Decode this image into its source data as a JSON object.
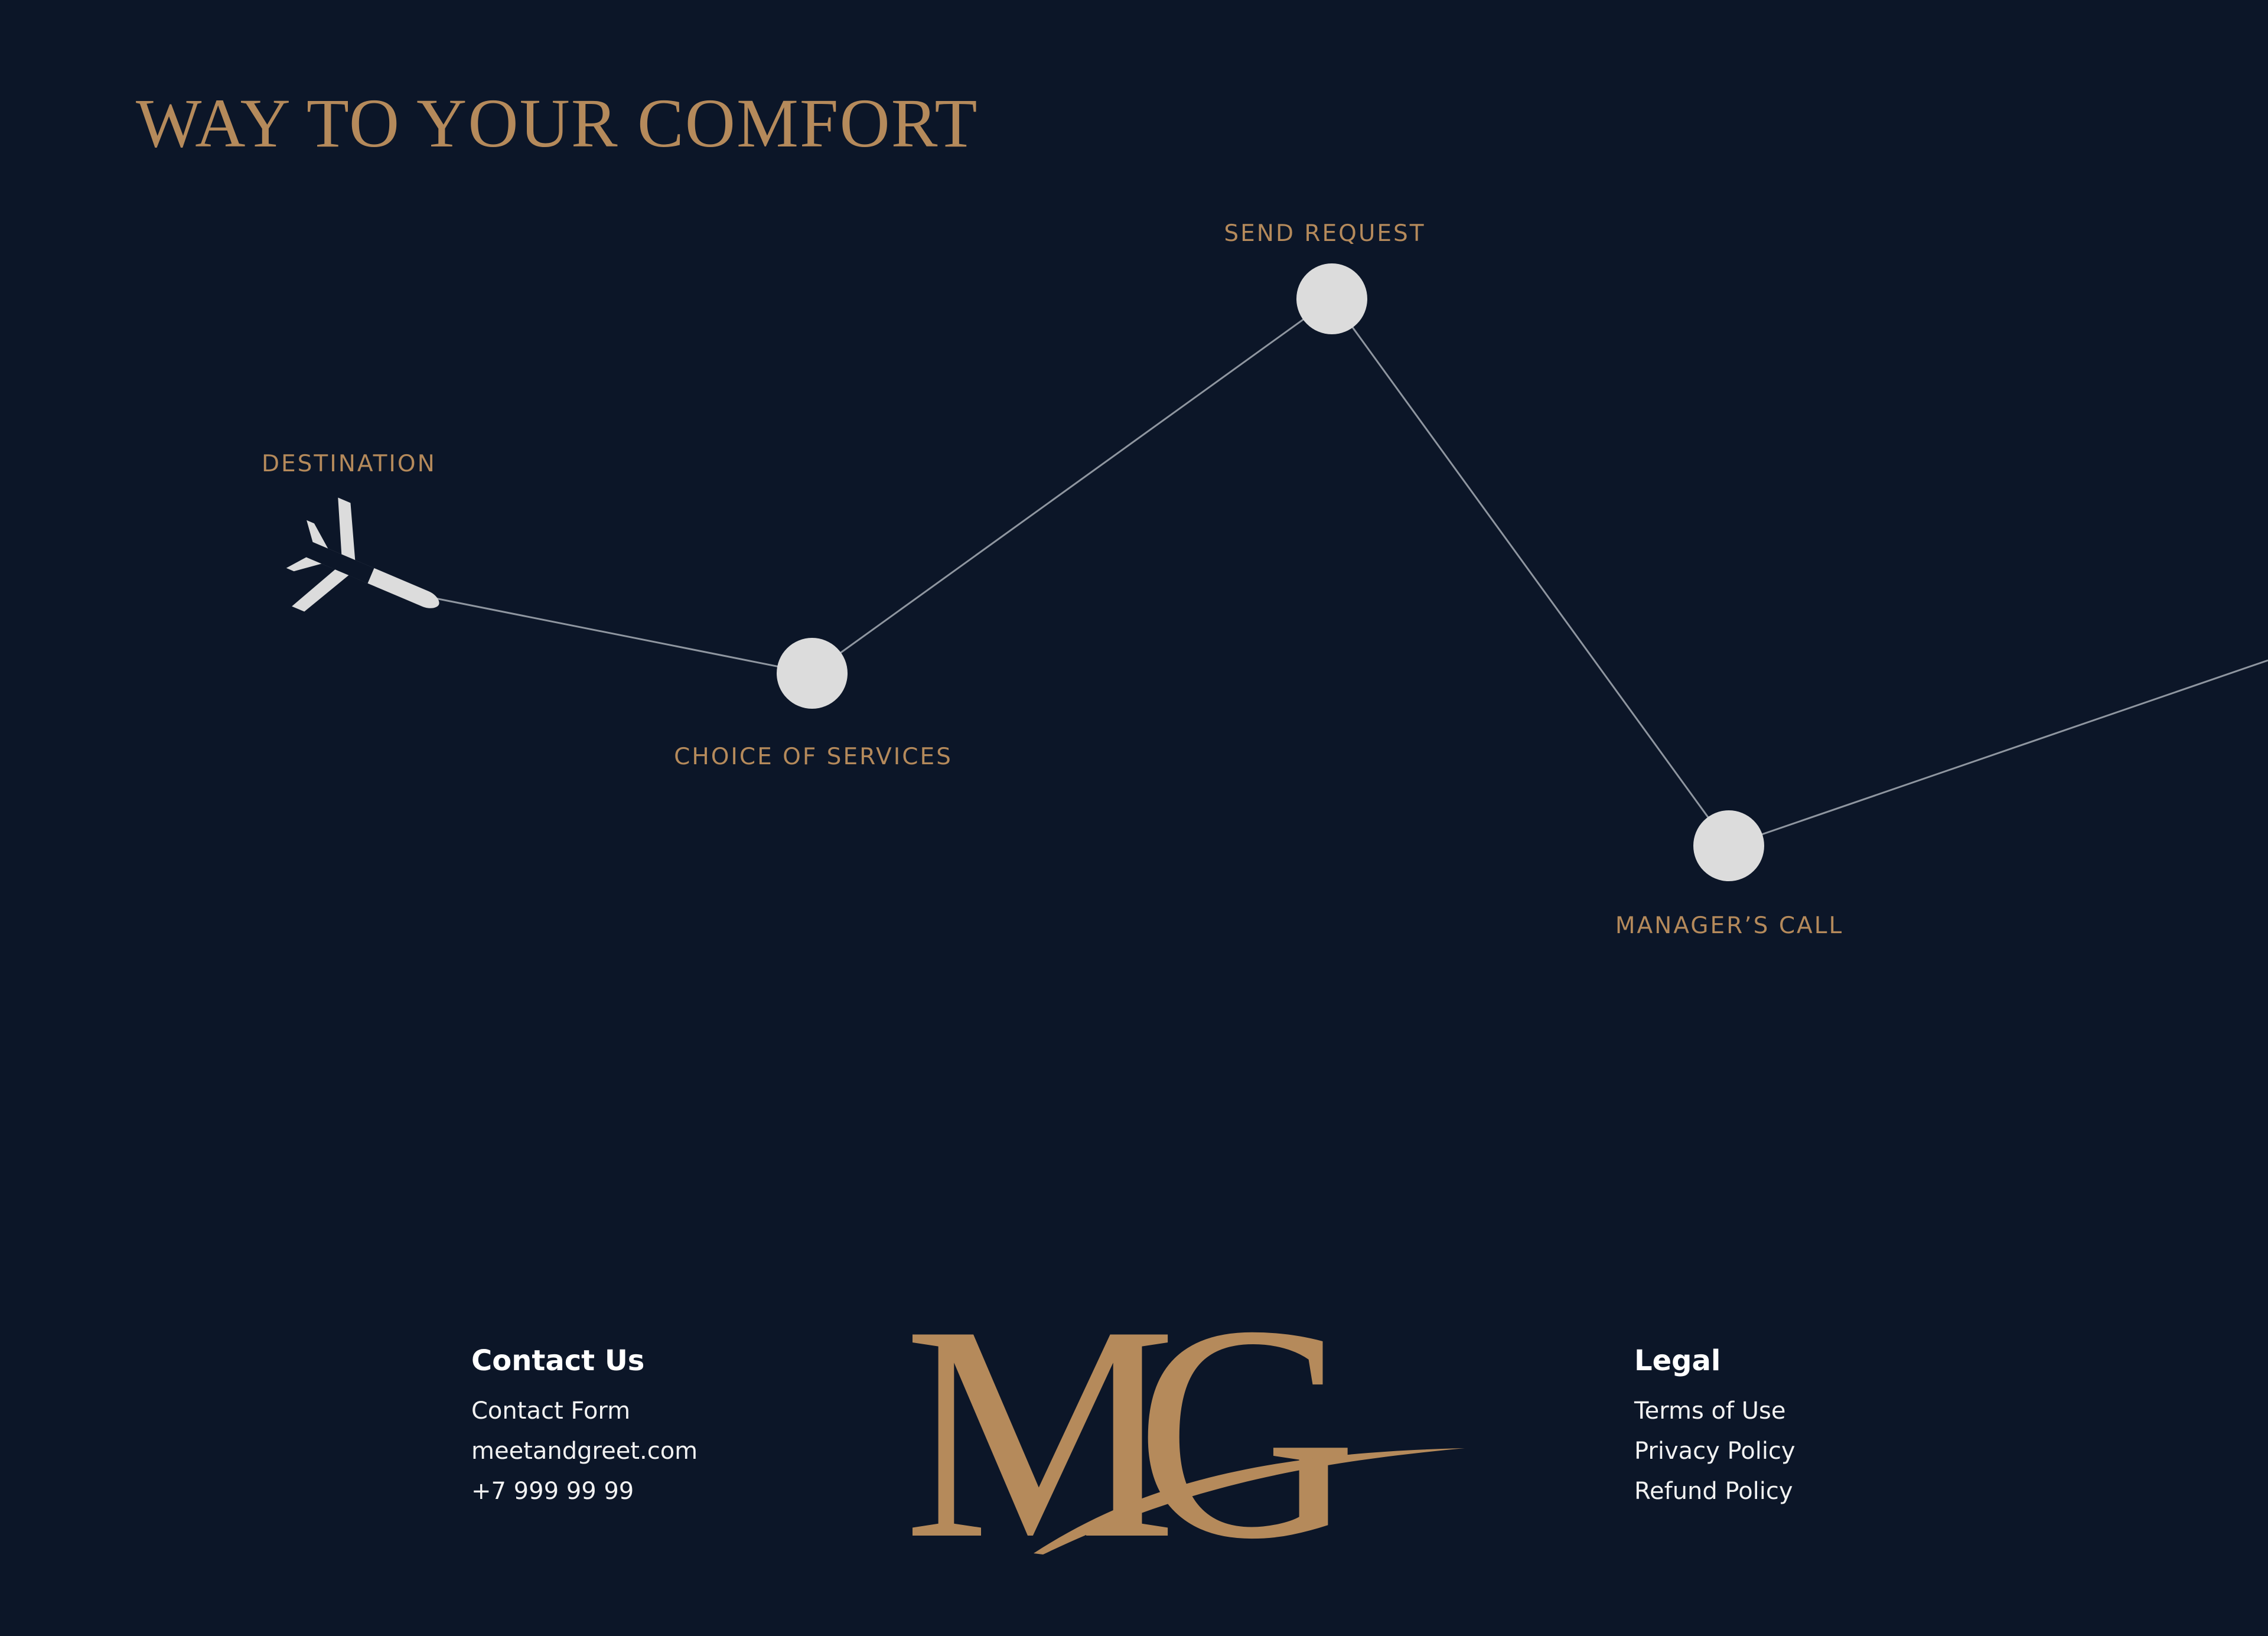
{
  "page": {
    "title": "WAY TO YOUR COMFORT",
    "colors": {
      "background": "#0c1628",
      "accent_gold": "#b58a5b",
      "node": "#dcdcdc",
      "line": "#8f96a0",
      "footer_text": "#ffffff"
    }
  },
  "route": {
    "icon": "airplane-icon",
    "steps": [
      {
        "label": "DESTINATION",
        "marker": "airplane"
      },
      {
        "label": "CHOICE OF SERVICES",
        "marker": "circle"
      },
      {
        "label": "SEND REQUEST",
        "marker": "circle"
      },
      {
        "label": "MANAGER’S CALL",
        "marker": "circle"
      }
    ]
  },
  "footer": {
    "contact": {
      "heading": "Contact Us",
      "items": [
        "Contact Form",
        "meetandgreet.com",
        "+7 999 99 99"
      ]
    },
    "logo": {
      "text": "MG"
    },
    "legal": {
      "heading": "Legal",
      "items": [
        "Terms of Use",
        "Privacy Policy",
        "Refund Policy"
      ]
    }
  }
}
